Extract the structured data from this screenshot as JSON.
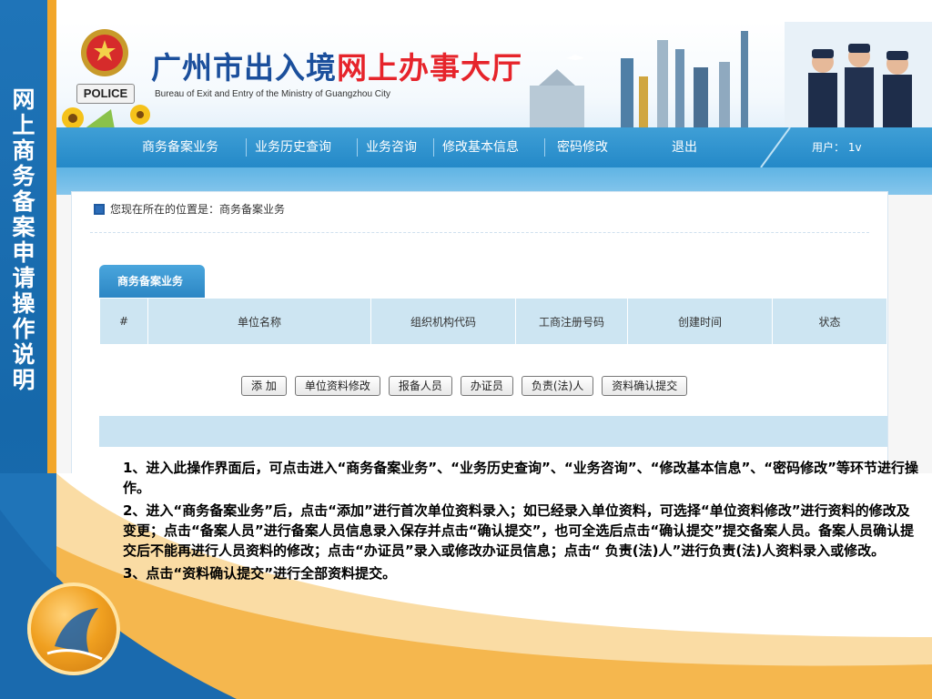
{
  "slide": {
    "side_title": "网上商务备案申请操作说明"
  },
  "site": {
    "police_label": "POLICE",
    "title_part1": "广州市出入境",
    "title_part2": "网上办事大厅",
    "subtitle": "Bureau of Exit and Entry of the Ministry of  Guangzhou City"
  },
  "nav": {
    "items": [
      {
        "label": "商务备案业务"
      },
      {
        "label": "业务历史查询"
      },
      {
        "label": "业务咨询"
      },
      {
        "label": "修改基本信息"
      },
      {
        "label": "密码修改"
      },
      {
        "label": "退出"
      }
    ],
    "user": "用户： 1v"
  },
  "breadcrumb": "您现在所在的位置是：商务备案业务",
  "tab_label": "商务备案业务",
  "table": {
    "columns": [
      "#",
      "单位名称",
      "组织机构代码",
      "工商注册号码",
      "创建时间",
      "状态"
    ]
  },
  "buttons": [
    "添 加",
    "单位资料修改",
    "报备人员",
    "办证员",
    "负责(法)人",
    "资料确认提交"
  ],
  "instructions": [
    "1、进入此操作界面后，可点击进入“商务备案业务”、“业务历史查询”、“业务咨询”、“修改基本信息”、“密码修改”等环节进行操作。",
    "2、进入“商务备案业务”后，点击“添加”进行首次单位资料录入；如已经录入单位资料，可选择“单位资料修改”进行资料的修改及变更；点击“备案人员”进行备案人员信息录入保存并点击“确认提交”，也可全选后点击“确认提交”提交备案人员。备案人员确认提交后不能再进行人员资料的修改；点击“办证员”录入或修改办证员信息；点击“ 负责(法)人”进行负责(法)人资料录入或修改。",
    "3、点击“资料确认提交”进行全部资料提交。"
  ],
  "colors": {
    "side_bar": "#1f74b8",
    "accent_orange": "#f2a62a",
    "nav_blue": "#2489c8",
    "title_blue": "#1b4f9c",
    "title_red": "#e6242b"
  }
}
